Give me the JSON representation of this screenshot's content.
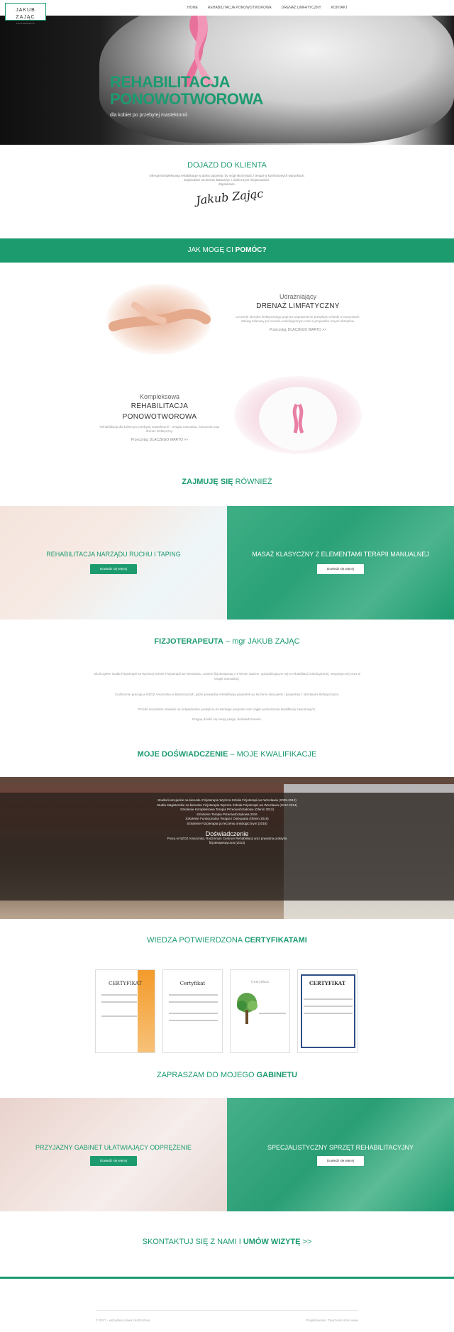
{
  "header": {
    "logo_name": "JAKUB ZAJĄC",
    "logo_sub": "FIZJOTERAPEUTA",
    "nav": [
      "HOME",
      "REHABILITACJA PONOWOTWOROWA",
      "DRENAŻ LIMFATYCZNY",
      "KONTAKT"
    ]
  },
  "hero": {
    "title_line1": "REHABILITACJA",
    "title_line2": "PONOWOTWOROWA",
    "tagline": "dla kobiet po przebytej mastektomii"
  },
  "dojazd": {
    "title": "DOJAZD DO KLIENTA",
    "line1": "Oferuję kompleksową rehabilitację w domu pacjenta, by mógł skorzystać z terapii w komfortowych warunkach.",
    "line2": "Dojeżdżam na terenie Bartoszyc i okolicznych miejscowości.",
    "line3": "Zapraszam.",
    "signature": "Jakub Zając"
  },
  "band": {
    "prefix": "JAK MOGĘ CI ",
    "bold": "POMÓC?"
  },
  "service1": {
    "small": "Udrażniający",
    "big": "DRENAŻ LIMFATYCZNY",
    "desc": "Leczenie obrzęku limfatycznego poprzez usprawnienie przepływu chłonki w naczyniach. Zabieg zalecany po leczeniu onkologicznym oraz w przypadku innych obrzęków.",
    "more": "Przeczytaj, DLACZEGO WARTO >>"
  },
  "service2": {
    "small": "Kompleksowa",
    "big": "REHABILITACJA PONOWOTWOROWA",
    "desc": "Rehabilitacja dla kobiet po przebytej mastektomii – terapia manualna, ćwiczenia oraz drenaż limfatyczny.",
    "more": "Przeczytaj, DLACZEGO WARTO >>"
  },
  "also": {
    "prefix": "ZAJMUJĘ SIĘ ",
    "rest": "RÓWNIEŻ"
  },
  "tile1": {
    "title": "REHABILITACJA NARZĄDU RUCHU I TAPING",
    "btn": "Dowiedz się więcej"
  },
  "tile2": {
    "title": "MASAŻ KLASYCZNY Z ELEMENTAMI TERAPII MANUALNEJ",
    "btn": "Dowiedz się więcej"
  },
  "about": {
    "title_bold": "FIZJOTERAPEUTA",
    "title_rest": " – mgr JAKUB ZAJĄC",
    "p1": "Ukończyłem studia Fizjoterapii na Wyższej Szkole Fizjoterapii we Wrocławiu. Jestem fizjoterapeutą z 5-letnim stażem, specjalizującym się w rehabilitacji onkologicznej, ortopedycznej oraz w terapii manualnej.",
    "p2": "Codziennie pracuję w NZOZ Amazonka w Bartoszycach, gdzie prowadzę rehabilitację pacjentek po leczeniu raka piersi i pacjentów z obrzękami limfatycznymi.",
    "p3": "Przede wszystkim stawiam na indywidualne podejście do każdego pacjenta oraz ciągłe podnoszenie kwalifikacji zawodowych.",
    "p4": "Pragnę dzielić się swoją pasją i doświadczeniem."
  },
  "experience_heading": {
    "bold": "MOJE DOŚWIADCZENIE",
    "rest": " – MOJE KWALIFIKACJE"
  },
  "experience": {
    "quals": [
      "Studia licencjackie na kierunku Fizjoterapia Wyższa Szkoła Fizjoterapii we Wrocławiu (2009-2012)",
      "Studia Magisterskie na kierunku Fizjoterapia Wyższa Szkoła Fizjoterapii we Wrocławiu (2012-2014)",
      "Szkolenie Kompleksowa Terapia Przeciwobrzękowa (Olenin 2012)",
      "Szkolenie Terapia Przeciwobrzękowa 2016",
      "Szkolenie Funkcjonalna Terapia i Osteopatia (Olenin 2016)",
      "Szkolenie Fizjoterapia po leczeniu onkologicznym (2018)"
    ],
    "sub_title": "Doświadczenie",
    "sub_text": "Praca w NZOZ Amazonka, Rodzinnym Centrum Rehabilitacji oraz prywatna praktyka fizjoterapeutyczna (2013)"
  },
  "certs_heading": {
    "prefix": "WIEDZA POTWIERDZONA ",
    "bold": "CERTYFIKATAMI"
  },
  "certs": [
    "CERTYFIKAT",
    "Certyfikat",
    "Certyfikat",
    "CERTYFIKAT"
  ],
  "cabinet_heading": {
    "prefix": "ZAPRASZAM DO MOJEGO ",
    "bold": "GABINETU"
  },
  "tile3": {
    "title": "PRZYJAZNY GABINET UŁATWIAJĄCY ODPRĘŻENIE",
    "btn": "Dowiedz się więcej"
  },
  "tile4": {
    "title": "SPECJALISTYCZNY SPRZĘT REHABILITACYJNY",
    "btn": "Dowiedz się więcej"
  },
  "contact": {
    "prefix": "SKONTAKTUJ SIĘ Z NAMI I ",
    "bold": "UMÓW WIZYTĘ",
    "arrow": " >>"
  },
  "footer": {
    "left": "© 2017 - wszystkie prawa zastrzeżone",
    "right": "Projektowanie: Tworzenie stron www"
  },
  "colors": {
    "brand": "#1c9b6f"
  }
}
